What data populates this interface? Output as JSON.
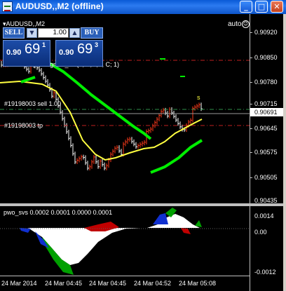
{
  "window": {
    "title": "AUDUSD,,M2 (offline)",
    "minimize_label": "_",
    "maximize_label": "□",
    "close_label": "✕"
  },
  "chart": {
    "symbol_label": "▾AUDUSD,,M2",
    "auto_label": "auto",
    "smiley_glyph": "☺",
    "indicator_label": "smCMScalper Signals_v1 (3, E,E,E, C; 1)",
    "order_sell_label": "#19198003 sell 1.00",
    "order_tp_label": "#19198003 tp",
    "signal_marker": "s",
    "current_price": "0.90691",
    "price_labels": [
      "0.90920",
      "0.90850",
      "0.90780",
      "0.90715",
      "0.90645",
      "0.90575",
      "0.90505",
      "0.90435"
    ],
    "time_labels": [
      "24 Mar 2014",
      "24 Mar 04:45",
      "24 Mar 04:45",
      "24 Mar 04:52",
      "24 Mar 05:08"
    ]
  },
  "one_click": {
    "sell_label": "SELL",
    "buy_label": "BUY",
    "lot_value": "1.00",
    "down_glyph": "▼",
    "up_glyph": "▲",
    "bid_small": "0.90",
    "bid_big": "69",
    "bid_sup": "1",
    "ask_small": "0.90",
    "ask_big": "69",
    "ask_sup": "3"
  },
  "subwindow": {
    "label": "pwo_svs 0.0002 0.0001 0.0000 0.0001",
    "scale_labels": [
      "0.0014",
      "0.00",
      "-0.0012"
    ]
  },
  "colors": {
    "bull_candle": "#ff3a1a",
    "bear_candle": "#ffffff",
    "yellow_ma": "#ffff40",
    "green_band": "#00ee00",
    "order_line": "#2f8f4a",
    "tp_line": "#c02020"
  }
}
